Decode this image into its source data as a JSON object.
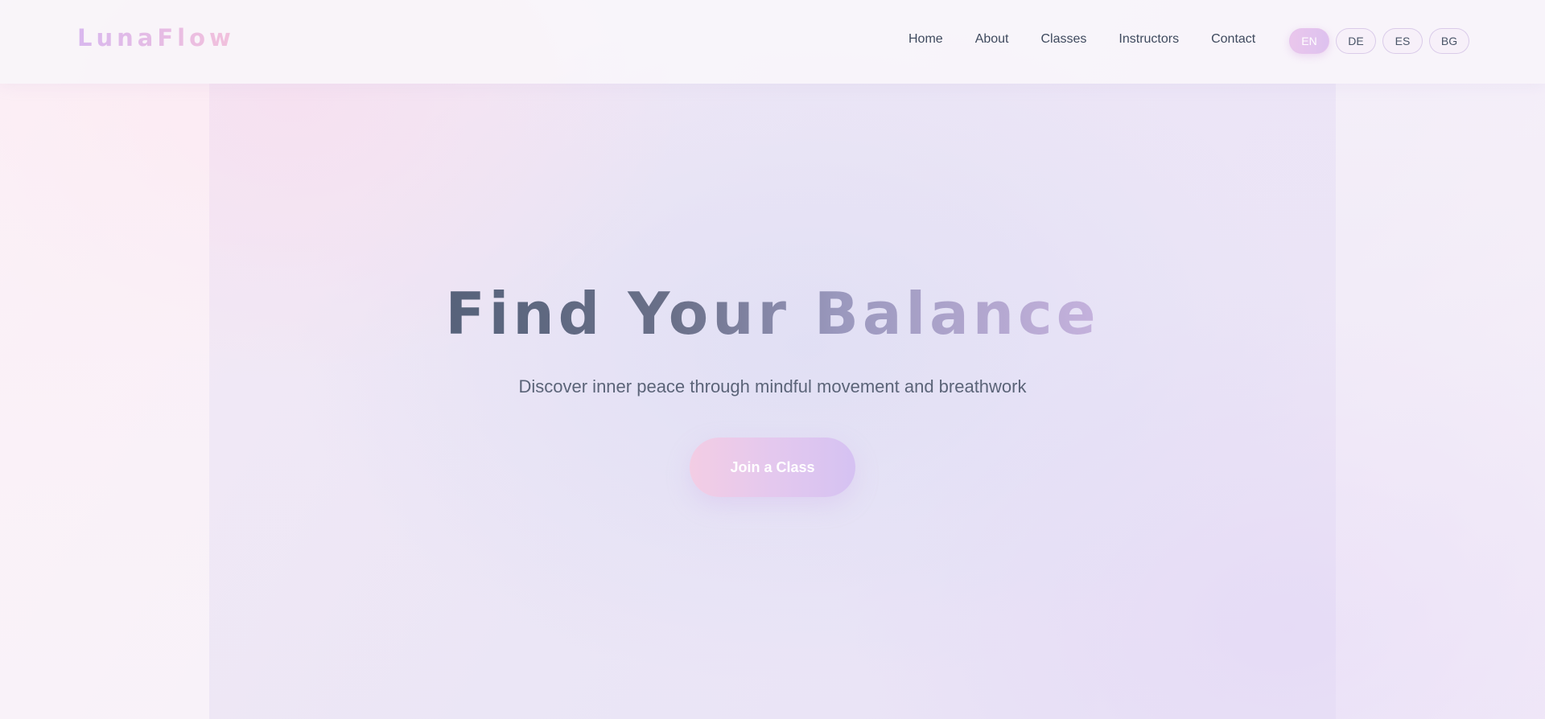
{
  "brand": {
    "logo": "LunaFlow"
  },
  "nav": {
    "items": [
      {
        "label": "Home"
      },
      {
        "label": "About"
      },
      {
        "label": "Classes"
      },
      {
        "label": "Instructors"
      },
      {
        "label": "Contact"
      }
    ]
  },
  "languages": {
    "active": "EN",
    "options": [
      {
        "label": "EN"
      },
      {
        "label": "DE"
      },
      {
        "label": "ES"
      },
      {
        "label": "BG"
      }
    ]
  },
  "hero": {
    "title": "Find Your Balance",
    "subtitle": "Discover inner peace through mindful movement and breathwork",
    "cta_label": "Join a Class"
  },
  "colors": {
    "text_primary": "#3f4a5e",
    "logo_gradient_start": "#d9b8ee",
    "logo_gradient_end": "#f2c0dc",
    "cta_gradient_start": "#f3cde4",
    "cta_gradient_end": "#d5c2f2",
    "title_gradient_start": "#56627a",
    "title_gradient_end": "#c5b2dd"
  }
}
